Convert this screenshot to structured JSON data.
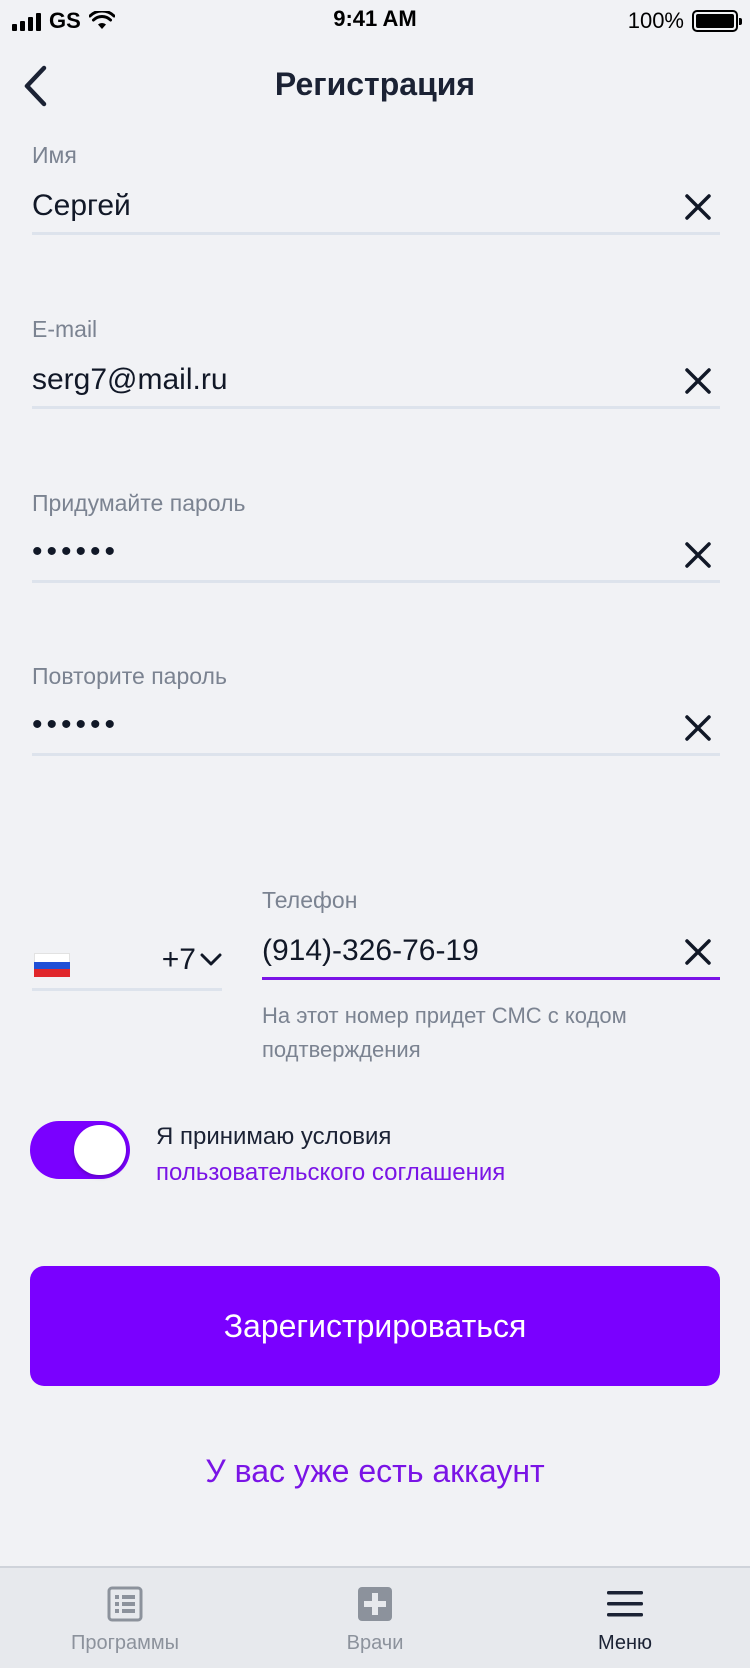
{
  "status_bar": {
    "carrier": "GS",
    "time": "9:41 AM",
    "battery": "100%"
  },
  "header": {
    "title": "Регистрация"
  },
  "fields": {
    "name": {
      "label": "Имя",
      "value": "Сергей"
    },
    "email": {
      "label": "E-mail",
      "value": "serg7@mail.ru"
    },
    "password": {
      "label": "Придумайте пароль",
      "value": "••••••"
    },
    "password_repeat": {
      "label": "Повторите пароль",
      "value": "••••••"
    }
  },
  "phone": {
    "country_code": "+7",
    "label": "Телефон",
    "value": "(914)-326-76-19",
    "hint": "На этот номер придет СМС с кодом подтверждения"
  },
  "terms": {
    "enabled": true,
    "text": "Я принимаю условия",
    "link": "пользовательского соглашения"
  },
  "actions": {
    "register": "Зарегистрироваться",
    "login": "У вас уже есть аккаунт"
  },
  "tabbar": {
    "items": [
      {
        "label": "Программы",
        "icon": "list-icon",
        "active": false
      },
      {
        "label": "Врачи",
        "icon": "medical-cross-icon",
        "active": false
      },
      {
        "label": "Меню",
        "icon": "menu-icon",
        "active": true
      }
    ]
  },
  "colors": {
    "accent": "#7a00ff",
    "link": "#7a14e6",
    "background": "#f1f2f5",
    "divider": "#dde3ec",
    "muted": "#7b8391"
  }
}
